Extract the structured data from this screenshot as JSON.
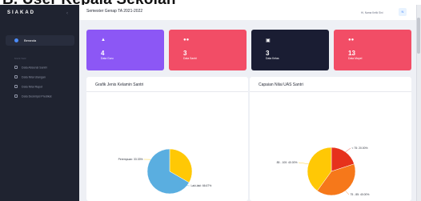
{
  "caption": "B. User Kepala Sekolah",
  "brand": "SIAKAD",
  "collapse_icon": "chevron-left-icon",
  "sidebar": {
    "main_item": "Beranda",
    "section_label": "MASTER",
    "items": [
      {
        "label": "Data Absensi Santri",
        "icon": "checkbox-icon"
      },
      {
        "label": "Data Nilai Ulangan",
        "icon": "document-icon"
      },
      {
        "label": "Data Nilai Rapot",
        "icon": "document-icon"
      },
      {
        "label": "Data Deskripsi Predikat",
        "icon": "document-icon"
      }
    ]
  },
  "topbar": {
    "semester": "Semester Genap TA 2021-2022",
    "user": "Hi, Nama Ketik Sini",
    "avatar_initial": "N"
  },
  "cards": [
    {
      "icon": "school-icon",
      "value": "4",
      "label": "Data Guru",
      "color": "#8c57f5"
    },
    {
      "icon": "people-icon",
      "value": "3",
      "label": "Data Santri",
      "color": "#f24d66"
    },
    {
      "icon": "door-icon",
      "value": "3",
      "label": "Data Kelas",
      "color": "#1a1d33"
    },
    {
      "icon": "people-icon",
      "value": "13",
      "label": "Data Mapel",
      "color": "#f24d66"
    }
  ],
  "panels": {
    "gender_title": "Grafik Jenis Kelamin Santri",
    "uas_title": "Capaian Nilai UAS Santri"
  },
  "chart_data": [
    {
      "type": "pie",
      "title": "Grafik Jenis Kelamin Santri",
      "slices": [
        {
          "label": "Perempuan",
          "value": 33.33,
          "display": "Perempuan: 33.33%",
          "color": "#ffc805"
        },
        {
          "label": "Laki-laki",
          "value": 66.67,
          "display": "Laki-laki: 66.67%",
          "color": "#5aaee0"
        }
      ]
    },
    {
      "type": "pie",
      "title": "Capaian Nilai UAS Santri",
      "slices": [
        {
          "label": "< 75",
          "value": 20.0,
          "display": "< 75: 20.00%",
          "color": "#e6311c"
        },
        {
          "label": "75 - 85",
          "value": 40.0,
          "display": "75 - 85: 40.00%",
          "color": "#f6781a"
        },
        {
          "label": "85 - 100",
          "value": 40.0,
          "display": "85 - 100: 40.00%",
          "color": "#ffc805"
        }
      ]
    }
  ]
}
